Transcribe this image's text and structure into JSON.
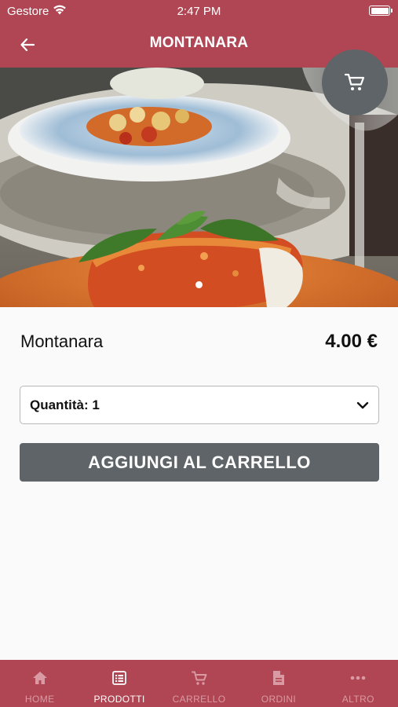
{
  "status_bar": {
    "carrier": "Gestore",
    "time": "2:47 PM"
  },
  "header": {
    "title": "MONTANARA",
    "back_icon": "arrow-left-icon",
    "cart_icon": "cart-icon"
  },
  "carousel": {
    "page_count": 1,
    "current_page": 1
  },
  "product": {
    "name": "Montanara",
    "price": "4.00 €"
  },
  "quantity_select": {
    "label": "Quantità: 1",
    "icon": "chevron-down-icon"
  },
  "add_to_cart_label": "AGGIUNGI AL CARRELLO",
  "tabs": [
    {
      "label": "HOME",
      "icon": "home-icon",
      "active": false
    },
    {
      "label": "PRODOTTI",
      "icon": "list-icon",
      "active": true
    },
    {
      "label": "CARRELLO",
      "icon": "cart-icon",
      "active": false
    },
    {
      "label": "ORDINI",
      "icon": "document-icon",
      "active": false
    },
    {
      "label": "ALTRO",
      "icon": "more-icon",
      "active": false
    }
  ],
  "colors": {
    "primary": "#b04654",
    "button": "#5e6467",
    "background": "#fafafa"
  }
}
